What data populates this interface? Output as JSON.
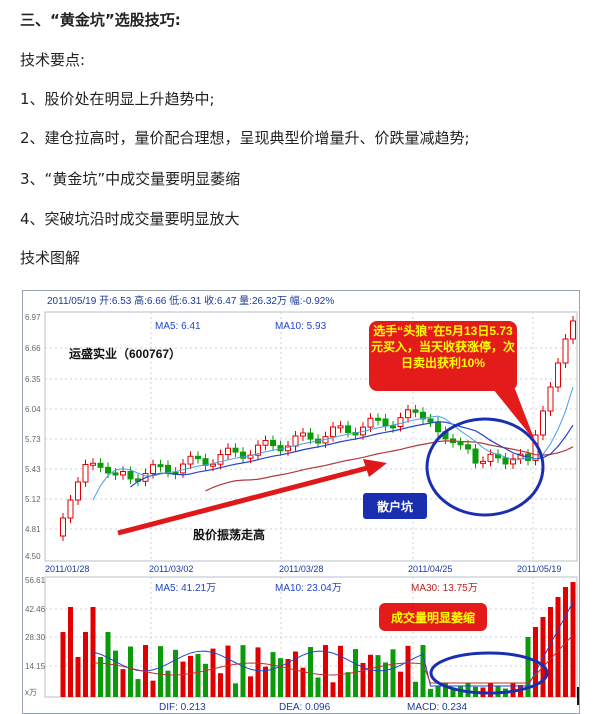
{
  "heading": "三、“黄金坑”选股技巧:",
  "points_label": "技术要点:",
  "points": [
    "1、股价处在明显上升趋势中;",
    "2、建仓拉高时，量价配合理想，呈现典型价增量升、价跌量减趋势;",
    "3、“黄金坑”中成交量要明显萎缩",
    "4、突破坑沿时成交量要明显放大"
  ],
  "diagram_label": "技术图解",
  "chart": {
    "info_line": "2011/05/19 开:6.53 高:6.66 低:6.31 收:6.47 量:26.32万 幅:-0.92%",
    "ma5": "MA5: 6.41",
    "ma10": "MA10: 5.93",
    "stock_name": "运盛实业（600767）",
    "price_ticks": [
      "6.97",
      "6.66",
      "6.35",
      "6.04",
      "5.73",
      "5.43",
      "5.12",
      "4.81",
      "4.50"
    ],
    "date_ticks": [
      "2011/01/28",
      "2011/03/02",
      "2011/03/28",
      "2011/04/25",
      "2011/05/19"
    ],
    "callout_top": "选手“头狼”在5月13日5.73元买入，当天收获涨停，次日卖出获利10%",
    "pit_label": "散户坑",
    "trend_label": "股价振荡走高",
    "vol_ma5": "MA5: 41.21万",
    "vol_ma10": "MA10: 23.04万",
    "vol_ma30": "MA30: 13.75万",
    "vol_ticks": [
      "56.61",
      "42.46",
      "28.30",
      "14.15",
      "x万"
    ],
    "vol_callout": "成交量明显萎缩",
    "bottom_labels": [
      "DIF: 0.213",
      "DEA: 0.096",
      "MACD: 0.234"
    ],
    "colors": {
      "up": "#e00000",
      "down": "#0a9a0a",
      "ma5": "#2244cc",
      "ma10": "#c03030",
      "ellipse": "#1a2fb0",
      "callout_bg": "#e31b1b",
      "callout_text": "#ffff00"
    }
  }
}
